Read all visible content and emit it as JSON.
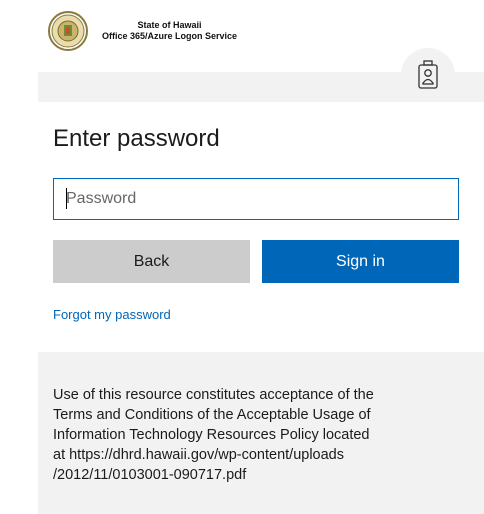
{
  "header": {
    "line1": "State of Hawaii",
    "line2": "Office 365/Azure Logon Service",
    "seal_icon": "state-seal-icon"
  },
  "badge_icon": "id-badge-icon",
  "title": "Enter password",
  "password": {
    "placeholder": "Password",
    "value": ""
  },
  "buttons": {
    "back": "Back",
    "signin": "Sign in"
  },
  "forgot_link": "Forgot my password",
  "notice": "Use of this resource constitutes acceptance of the\nTerms and Conditions of the Acceptable Usage of\nInformation Technology Resources Policy located\nat https://dhrd.hawaii.gov/wp-content/uploads\n/2012/11/0103001-090717.pdf",
  "colors": {
    "accent": "#0067b8",
    "back_button": "#cccccc",
    "panel": "#f2f2f2"
  }
}
